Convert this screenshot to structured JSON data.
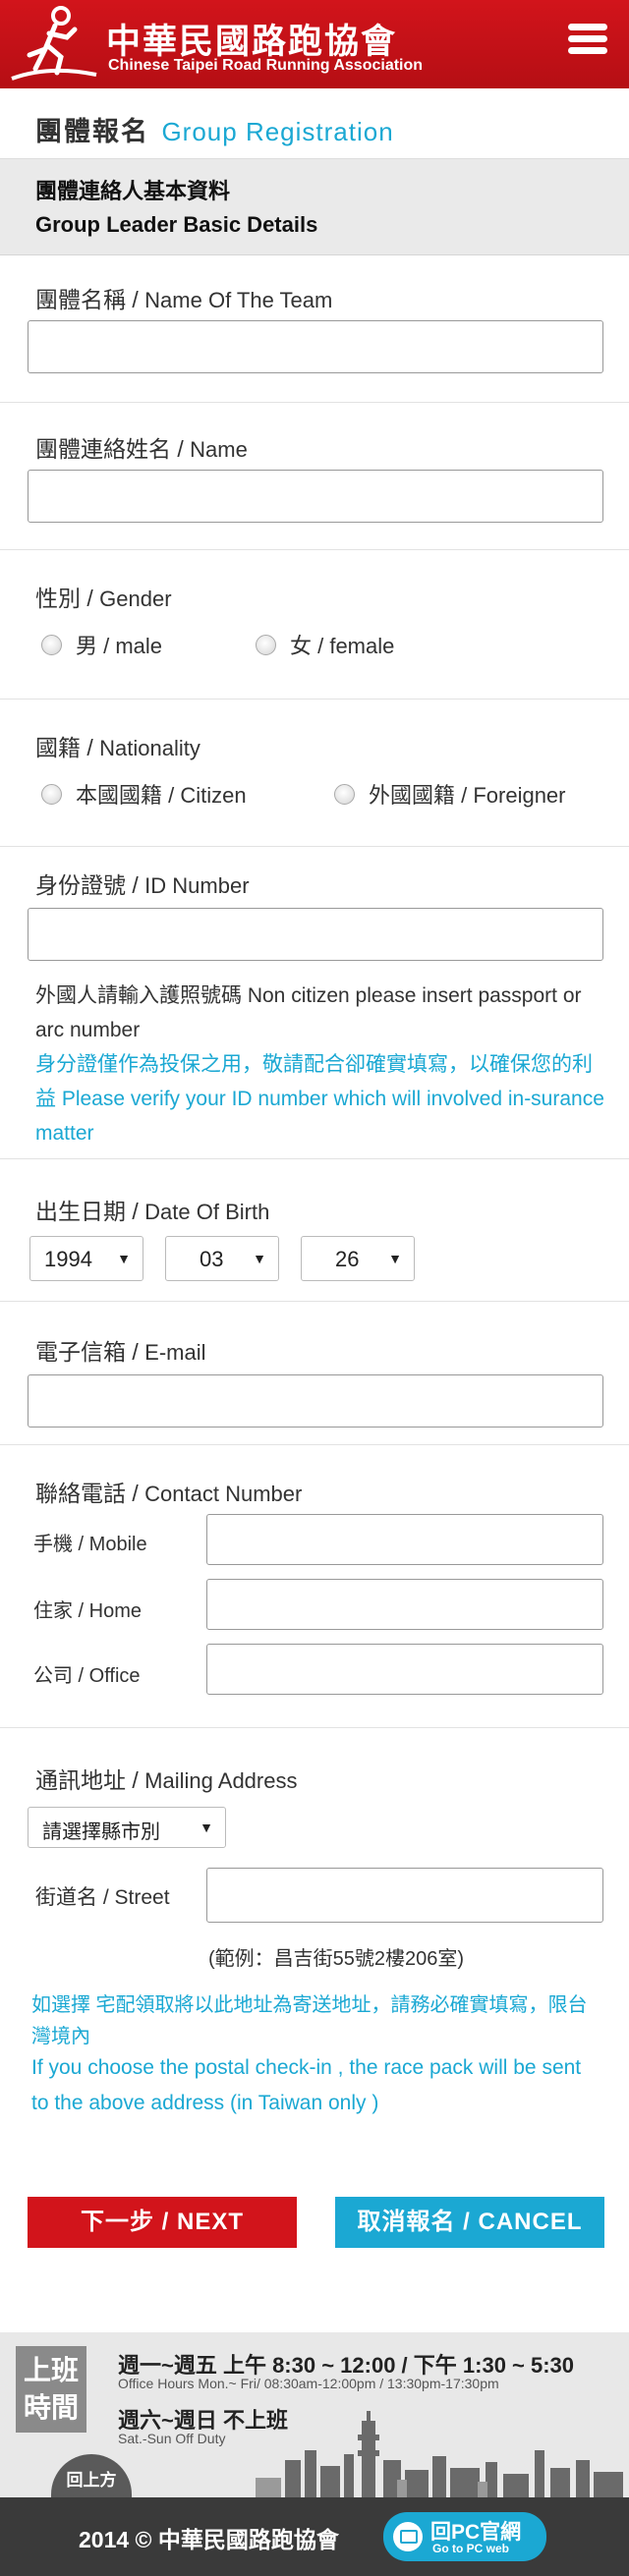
{
  "header": {
    "brand_zh": "中華民國路跑協會",
    "brand_en": "Chinese Taipei Road Running Association",
    "menu_icon": "hamburger-menu-icon",
    "logo_icon": "runner-logo-icon"
  },
  "title": {
    "zh": "團體報名",
    "en": "Group Registration"
  },
  "section": {
    "zh": "團體連絡人基本資料",
    "en": "Group Leader Basic Details"
  },
  "fields": {
    "team_name": {
      "zh": "團體名稱 / ",
      "en": "Name Of The Team"
    },
    "contact_name": {
      "zh": "團體連絡姓名 / ",
      "en": "Name"
    },
    "gender": {
      "zh": "性別 / ",
      "en": "Gender",
      "options": [
        "男 / male",
        "女 / female"
      ]
    },
    "nationality": {
      "zh": "國籍 / ",
      "en": "Nationality",
      "options": [
        "本國國籍 / Citizen",
        "外國國籍 / Foreigner"
      ]
    },
    "id_number": {
      "zh": "身份證號 / ",
      "en": "ID Number",
      "note_grey": "外國人請輸入護照號碼 Non citizen please insert passport or arc number",
      "note_blue": "身分證僅作為投保之用，敬請配合卻確實填寫，以確保您的利益 Please verify your ID number which will involved in-surance matter"
    },
    "dob": {
      "zh": "出生日期 / ",
      "en": "Date Of Birth",
      "year": "1994",
      "month": "03",
      "day": "26"
    },
    "email": {
      "zh": "電子信箱 / ",
      "en": "E-mail"
    },
    "contact_number": {
      "zh": "聯絡電話 / ",
      "en": "Contact Number",
      "mobile": "手機 / Mobile",
      "home": "住家 / Home",
      "office": "公司 / Office"
    },
    "address": {
      "zh": "通訊地址 / ",
      "en": "Mailing Address",
      "city_select": "請選擇縣市別",
      "street": "街道名 / Street",
      "example": "(範例：昌吉街55號2樓206室)",
      "note_zh": "如選擇 宅配領取將以此地址為寄送地址，請務必確實填寫，限台灣境內",
      "note_en": "If you choose the postal check-in , the race pack will be sent to  the above address (in Taiwan only )"
    }
  },
  "buttons": {
    "next": "下一步 /  NEXT",
    "cancel": "取消報名 / CANCEL"
  },
  "office_hours": {
    "badge": [
      "上班",
      "時間"
    ],
    "weekday": "週一~週五 上午 8:30 ~ 12:00 / 下午 1:30 ~ 5:30",
    "weekday_en": "Office Hours  Mon.~ Fri/ 08:30am-12:00pm / 13:30pm-17:30pm",
    "weekend": "週六~週日 不上班",
    "weekend_en": "Sat.-Sun Off Duty",
    "to_top": "回上方"
  },
  "footer": {
    "copyright": "2014 © 中華民國路跑協會",
    "pc_zh": "回PC官網",
    "pc_en": "Go to PC web"
  },
  "colors": {
    "brand_red": "#d2141b",
    "accent_blue": "#1ba8d3"
  }
}
